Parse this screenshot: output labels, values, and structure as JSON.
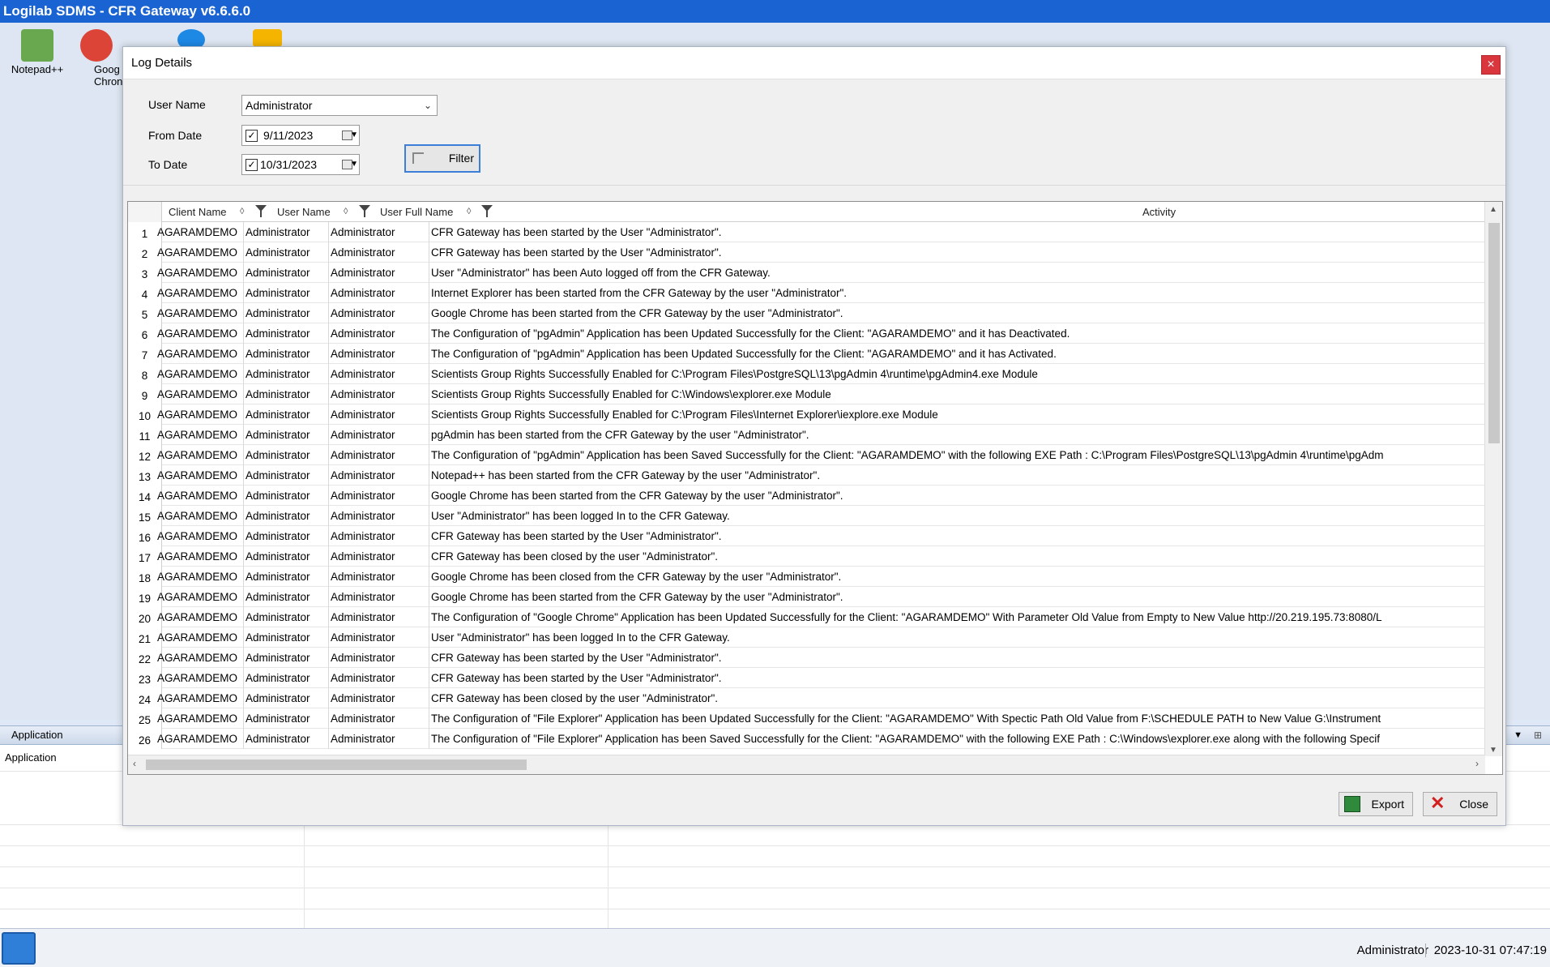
{
  "window": {
    "title": "Logilab SDMS - CFR Gateway v6.6.6.0"
  },
  "desktop_icons": [
    {
      "label": "Notepad++",
      "icon": "notepad-icon",
      "color": "#6aa84f"
    },
    {
      "label": "Goog\nChron",
      "icon": "chrome-icon",
      "color": "#db4437"
    },
    {
      "label": "",
      "icon": "internet-explorer-icon",
      "color": "#1e88e5"
    },
    {
      "label": "",
      "icon": "folder-icon",
      "color": "#f4b400"
    }
  ],
  "dialog": {
    "title": "Log Details",
    "close_glyph": "×",
    "user_name_label": "User Name",
    "user_name_value": "Administrator",
    "from_date_label": "From Date",
    "from_date_value": "9/11/2023",
    "from_date_checked": true,
    "to_date_label": "To Date",
    "to_date_value": "10/31/2023",
    "to_date_checked": true,
    "filter_label": "Filter",
    "export_label": "Export",
    "close_label": "Close"
  },
  "grid": {
    "columns": [
      "Client Name",
      "User Name",
      "User Full Name",
      "Activity"
    ],
    "rows": [
      {
        "n": "1",
        "client": "AGARAMDEMO",
        "user": "Administrator",
        "full": "Administrator",
        "activity": "CFR Gateway has been started by the User \"Administrator\"."
      },
      {
        "n": "2",
        "client": "AGARAMDEMO",
        "user": "Administrator",
        "full": "Administrator",
        "activity": "CFR Gateway has been started by the User \"Administrator\"."
      },
      {
        "n": "3",
        "client": "AGARAMDEMO",
        "user": "Administrator",
        "full": "Administrator",
        "activity": "User \"Administrator\" has been Auto logged off from the CFR Gateway."
      },
      {
        "n": "4",
        "client": "AGARAMDEMO",
        "user": "Administrator",
        "full": "Administrator",
        "activity": "Internet Explorer has been started from the CFR Gateway by the user \"Administrator\"."
      },
      {
        "n": "5",
        "client": "AGARAMDEMO",
        "user": "Administrator",
        "full": "Administrator",
        "activity": "Google Chrome has been started from the CFR Gateway by the user \"Administrator\"."
      },
      {
        "n": "6",
        "client": "AGARAMDEMO",
        "user": "Administrator",
        "full": "Administrator",
        "activity": "The Configuration of \"pgAdmin\" Application has been Updated Successfully for the Client: \"AGARAMDEMO\" and it has Deactivated."
      },
      {
        "n": "7",
        "client": "AGARAMDEMO",
        "user": "Administrator",
        "full": "Administrator",
        "activity": "The Configuration of \"pgAdmin\" Application has been Updated Successfully for the Client: \"AGARAMDEMO\" and it has Activated."
      },
      {
        "n": "8",
        "client": "AGARAMDEMO",
        "user": "Administrator",
        "full": "Administrator",
        "activity": "Scientists Group Rights Successfully Enabled for C:\\Program Files\\PostgreSQL\\13\\pgAdmin 4\\runtime\\pgAdmin4.exe Module"
      },
      {
        "n": "9",
        "client": "AGARAMDEMO",
        "user": "Administrator",
        "full": "Administrator",
        "activity": "Scientists Group Rights Successfully Enabled for C:\\Windows\\explorer.exe Module"
      },
      {
        "n": "10",
        "client": "AGARAMDEMO",
        "user": "Administrator",
        "full": "Administrator",
        "activity": "Scientists Group Rights Successfully Enabled for C:\\Program Files\\Internet Explorer\\iexplore.exe Module"
      },
      {
        "n": "11",
        "client": "AGARAMDEMO",
        "user": "Administrator",
        "full": "Administrator",
        "activity": "pgAdmin has been started from the CFR Gateway by the user \"Administrator\"."
      },
      {
        "n": "12",
        "client": "AGARAMDEMO",
        "user": "Administrator",
        "full": "Administrator",
        "activity": "The Configuration of \"pgAdmin\" Application has been Saved Successfully for the Client: \"AGARAMDEMO\" with the following EXE Path : C:\\Program Files\\PostgreSQL\\13\\pgAdmin 4\\runtime\\pgAdm"
      },
      {
        "n": "13",
        "client": "AGARAMDEMO",
        "user": "Administrator",
        "full": "Administrator",
        "activity": "Notepad++ has been started from the CFR Gateway by the user \"Administrator\"."
      },
      {
        "n": "14",
        "client": "AGARAMDEMO",
        "user": "Administrator",
        "full": "Administrator",
        "activity": "Google Chrome has been started from the CFR Gateway by the user \"Administrator\"."
      },
      {
        "n": "15",
        "client": "AGARAMDEMO",
        "user": "Administrator",
        "full": "Administrator",
        "activity": "User \"Administrator\" has been logged In to the CFR Gateway."
      },
      {
        "n": "16",
        "client": "AGARAMDEMO",
        "user": "Administrator",
        "full": "Administrator",
        "activity": "CFR Gateway has been started by the User \"Administrator\"."
      },
      {
        "n": "17",
        "client": "AGARAMDEMO",
        "user": "Administrator",
        "full": "Administrator",
        "activity": "CFR Gateway has been closed by the user \"Administrator\"."
      },
      {
        "n": "18",
        "client": "AGARAMDEMO",
        "user": "Administrator",
        "full": "Administrator",
        "activity": "Google Chrome has been closed from the CFR Gateway by the user \"Administrator\"."
      },
      {
        "n": "19",
        "client": "AGARAMDEMO",
        "user": "Administrator",
        "full": "Administrator",
        "activity": "Google Chrome has been started from the CFR Gateway by the user \"Administrator\"."
      },
      {
        "n": "20",
        "client": "AGARAMDEMO",
        "user": "Administrator",
        "full": "Administrator",
        "activity": "The Configuration of \"Google Chrome\" Application has been Updated Successfully for the Client: \"AGARAMDEMO\" With Parameter Old Value from Empty to New Value http://20.219.195.73:8080/L"
      },
      {
        "n": "21",
        "client": "AGARAMDEMO",
        "user": "Administrator",
        "full": "Administrator",
        "activity": "User \"Administrator\" has been logged In to the CFR Gateway."
      },
      {
        "n": "22",
        "client": "AGARAMDEMO",
        "user": "Administrator",
        "full": "Administrator",
        "activity": "CFR Gateway has been started by the User \"Administrator\"."
      },
      {
        "n": "23",
        "client": "AGARAMDEMO",
        "user": "Administrator",
        "full": "Administrator",
        "activity": "CFR Gateway has been started by the User \"Administrator\"."
      },
      {
        "n": "24",
        "client": "AGARAMDEMO",
        "user": "Administrator",
        "full": "Administrator",
        "activity": "CFR Gateway has been closed by the user \"Administrator\"."
      },
      {
        "n": "25",
        "client": "AGARAMDEMO",
        "user": "Administrator",
        "full": "Administrator",
        "activity": "The Configuration of \"File Explorer\" Application has been Updated Successfully for the Client: \"AGARAMDEMO\" With Spectic Path Old Value from F:\\SCHEDULE PATH to New Value G:\\Instrument"
      },
      {
        "n": "26",
        "client": "AGARAMDEMO",
        "user": "Administrator",
        "full": "Administrator",
        "activity": "The Configuration of \"File Explorer\" Application has been Saved Successfully for the Client: \"AGARAMDEMO\" with the following EXE Path : C:\\Windows\\explorer.exe along with the following Specif"
      }
    ]
  },
  "application_panel": {
    "header": "Application",
    "row_label": "Application"
  },
  "status": {
    "user": "Administrator",
    "datetime": "2023-10-31 07:47:19"
  },
  "colors": {
    "titlebar": "#1a63d2",
    "accent_border": "#3c7fd8",
    "close_red": "#d9363e"
  }
}
